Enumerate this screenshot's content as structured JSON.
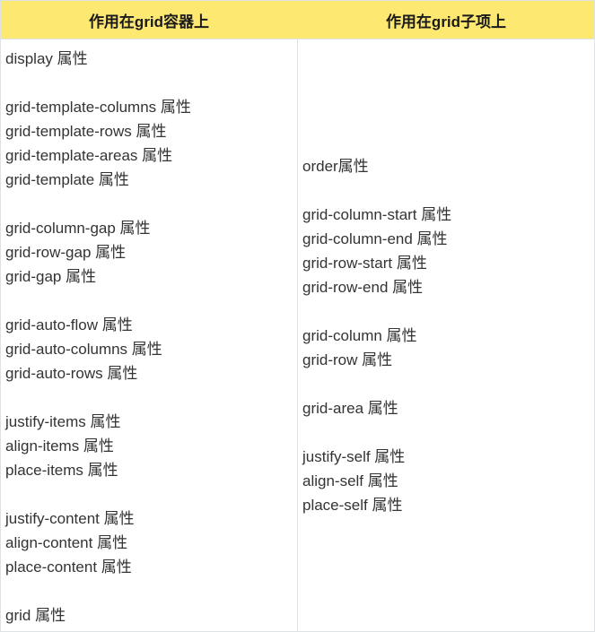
{
  "table": {
    "headers": [
      "作用在grid容器上",
      "作用在grid子项上"
    ],
    "container_groups": [
      [
        "display 属性"
      ],
      [
        "grid-template-columns 属性",
        "grid-template-rows 属性",
        "grid-template-areas 属性",
        "grid-template 属性"
      ],
      [
        "grid-column-gap 属性",
        "grid-row-gap 属性",
        "grid-gap 属性"
      ],
      [
        "grid-auto-flow 属性",
        "grid-auto-columns 属性",
        "grid-auto-rows 属性"
      ],
      [
        "justify-items 属性",
        "align-items 属性",
        "place-items 属性"
      ],
      [
        "justify-content 属性",
        "align-content 属性",
        "place-content 属性"
      ],
      [
        "grid 属性"
      ]
    ],
    "item_groups": [
      [
        "order属性"
      ],
      [
        "grid-column-start 属性",
        "grid-column-end 属性",
        "grid-row-start 属性",
        "grid-row-end 属性"
      ],
      [
        "grid-column 属性",
        "grid-row 属性"
      ],
      [
        "grid-area 属性"
      ],
      [
        "justify-self 属性",
        "align-self 属性",
        "place-self 属性"
      ]
    ]
  },
  "colors": {
    "header_bg": "#fde872",
    "border": "#dfe2e5",
    "text": "#333333"
  }
}
